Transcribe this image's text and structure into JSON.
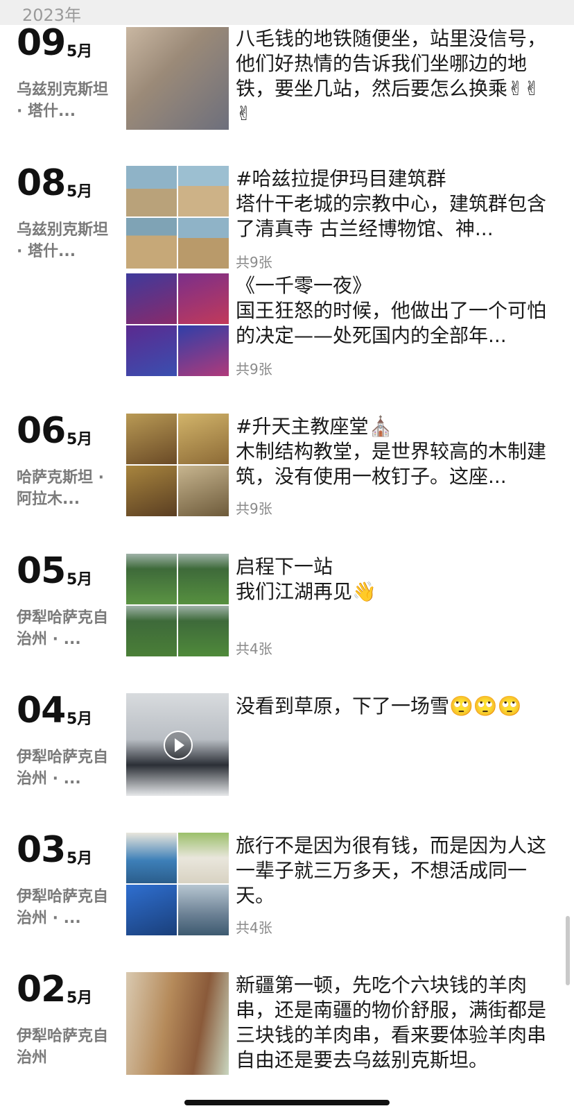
{
  "header": {
    "year": "2023年"
  },
  "entries": [
    {
      "day": "09",
      "month": "5月",
      "location": "乌兹别克斯坦 · 塔什...",
      "posts": [
        {
          "text": "八毛钱的地铁随便坐，站里没信号，他们好热情的告诉我们坐哪边的地铁，要坐几站，然后要怎么换乘✌✌✌",
          "count": "",
          "thumb_kind": "photo",
          "palette": [
            "#c9b7a2",
            "#6d6f7c"
          ]
        }
      ]
    },
    {
      "day": "08",
      "month": "5月",
      "location": "乌兹别克斯坦 · 塔什...",
      "posts": [
        {
          "text": "#哈兹拉提伊玛目建筑群\n塔什干老城的宗教中心，建筑群包含了清真寺 古兰经博物馆、神...",
          "count": "共9张",
          "thumb_kind": "grid",
          "palette": [
            "#b9a27a",
            "#8fb3c7",
            "#cdb287",
            "#7fa3b5"
          ]
        },
        {
          "text": "《一千零一夜》\n国王狂怒的时候，他做出了一个可怕的决定——处死国内的全部年...",
          "count": "共9张",
          "thumb_kind": "grid",
          "palette": [
            "#5b2a8f",
            "#8a2a6a",
            "#3e3a9c",
            "#7a2f8a"
          ]
        }
      ]
    },
    {
      "day": "06",
      "month": "5月",
      "location": "哈萨克斯坦 · 阿拉木...",
      "posts": [
        {
          "text": "#升天主教座堂⛪\n木制结构教堂，是世界较高的木制建筑，没有使用一枚钉子。这座...",
          "count": "共9张",
          "thumb_kind": "grid",
          "palette": [
            "#9a7a3e",
            "#b99a55",
            "#8c6a36",
            "#c7b58f"
          ]
        }
      ]
    },
    {
      "day": "05",
      "month": "5月",
      "location": "伊犁哈萨克自治州 · ...",
      "posts": [
        {
          "text": "启程下一站\n我们江湖再见👋",
          "count": "共4张",
          "thumb_kind": "grid",
          "palette": [
            "#4f8a3a",
            "#5b9443",
            "#4a7f37",
            "#56903f"
          ]
        }
      ]
    },
    {
      "day": "04",
      "month": "5月",
      "location": "伊犁哈萨克自治州 · ...",
      "posts": [
        {
          "text": "没看到草原，下了一场雪🙄🙄🙄",
          "count": "",
          "thumb_kind": "video",
          "palette": [
            "#d8dbde",
            "#2b2f36"
          ]
        }
      ]
    },
    {
      "day": "03",
      "month": "5月",
      "location": "伊犁哈萨克自治州 · ...",
      "posts": [
        {
          "text": "旅行不是因为很有钱，而是因为人这一辈子就三万多天，不想活成同一天。",
          "count": "共4张",
          "thumb_kind": "grid",
          "palette": [
            "#3d7fb8",
            "#e9e6dc",
            "#2f6fd0",
            "#6a7f93"
          ]
        }
      ]
    },
    {
      "day": "02",
      "month": "5月",
      "location": "伊犁哈萨克自治州",
      "posts": [
        {
          "text": "新疆第一顿，先吃个六块钱的羊肉串，还是南疆的物价舒服，满街都是三块钱的羊肉串，看来要体验羊肉串自由还是要去乌兹别克斯坦。",
          "count": "",
          "thumb_kind": "photo",
          "palette": [
            "#8a5a3a",
            "#d9c9b0"
          ]
        }
      ]
    }
  ]
}
